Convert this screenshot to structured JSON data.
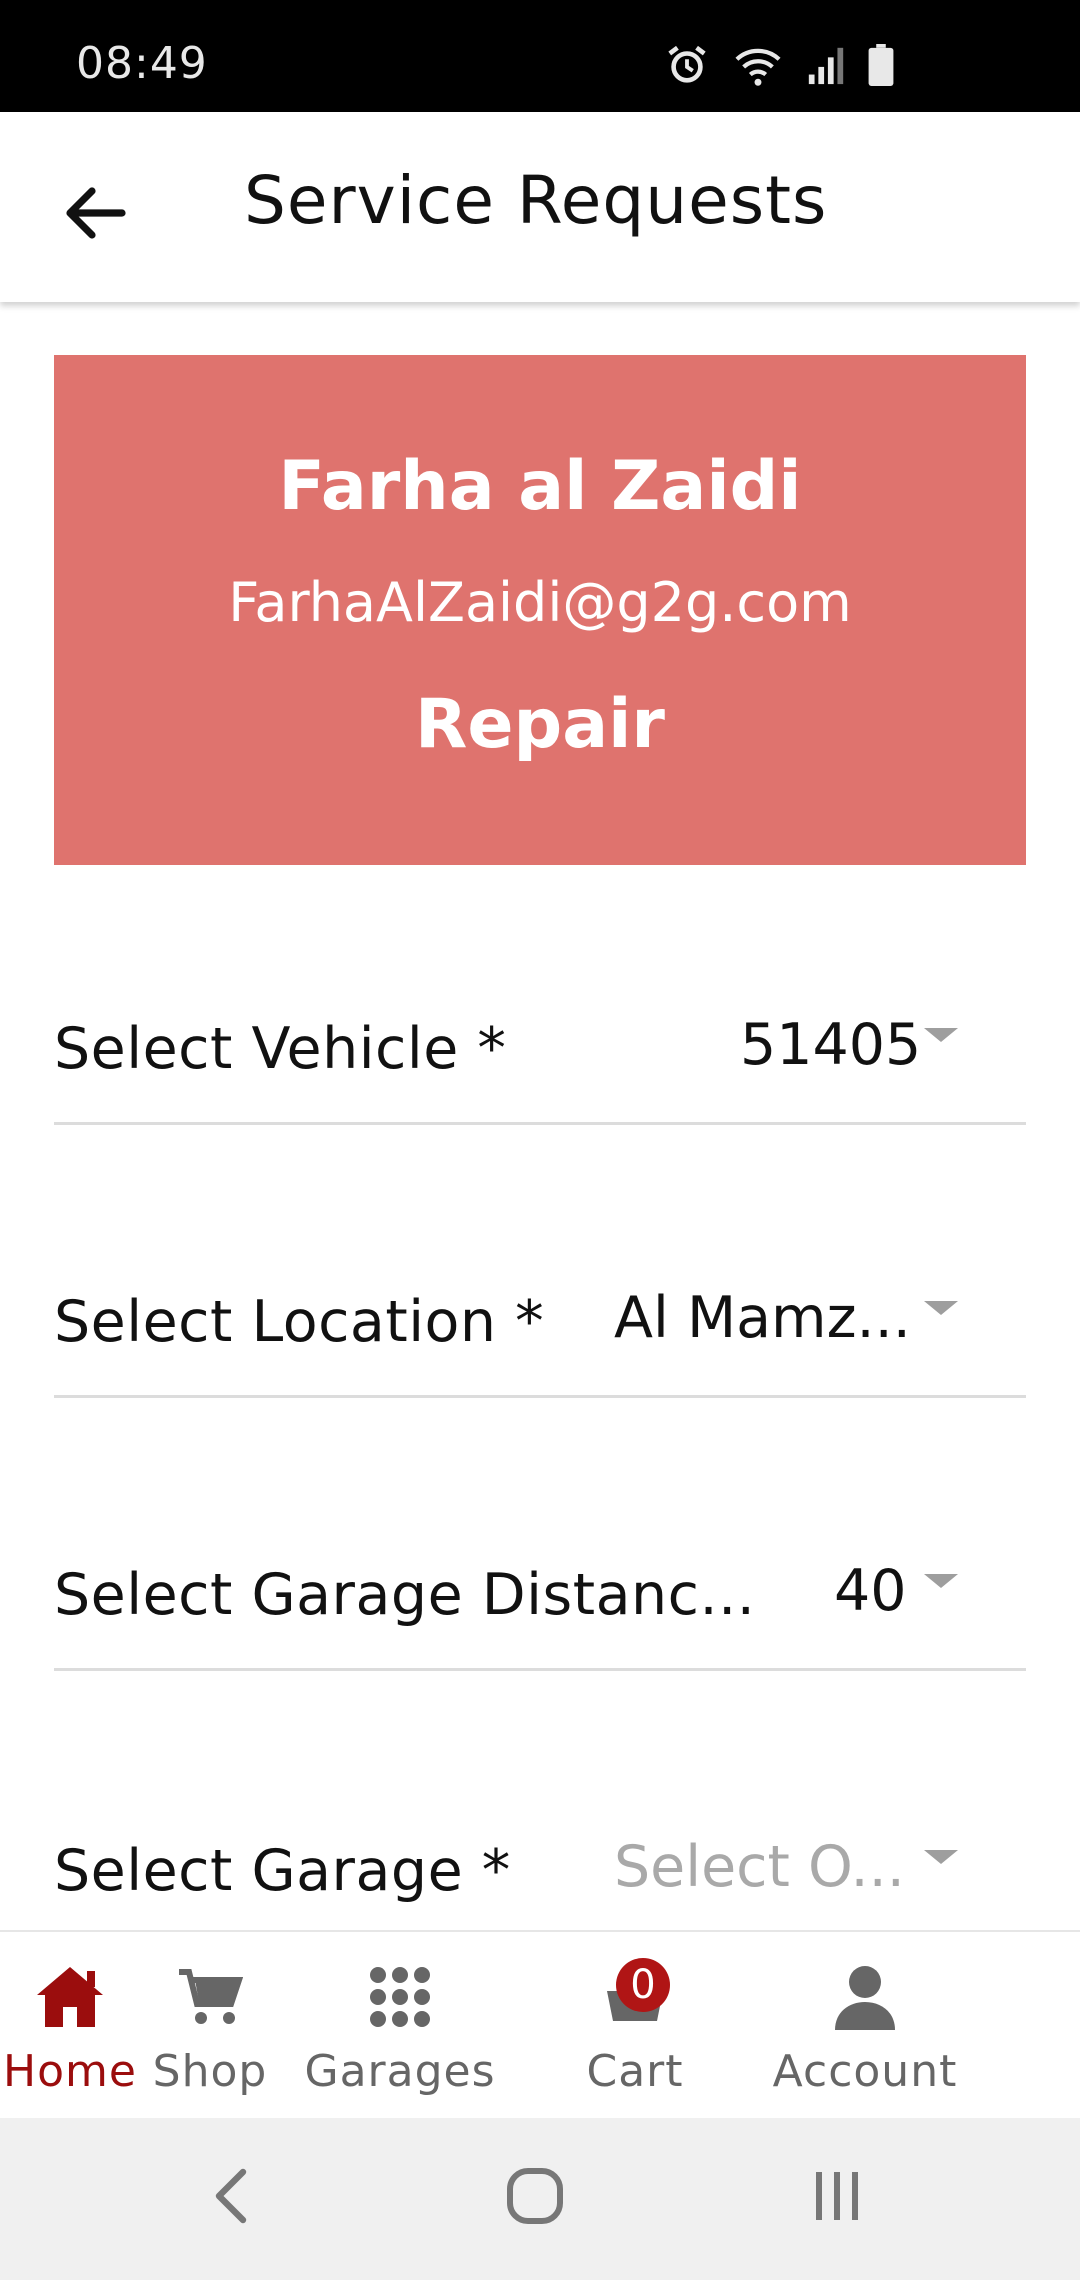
{
  "status_bar": {
    "time": "08:49",
    "icons": [
      "alarm-icon",
      "wifi-icon",
      "signal-icon",
      "battery-icon"
    ]
  },
  "header": {
    "title": "Service Requests",
    "back_icon": "arrow-left-icon"
  },
  "banner": {
    "name": "Farha al Zaidi",
    "email": "FarhaAlZaidi@g2g.com",
    "service_type": "Repair",
    "background_color": "#df736e"
  },
  "form": {
    "vehicle": {
      "label": "Select Vehicle *",
      "value": "51405"
    },
    "location": {
      "label": "Select Location *",
      "value": "Al Mamz..."
    },
    "garage_distance": {
      "label": "Select Garage Distanc...",
      "value": "40"
    },
    "garage": {
      "label": "Select Garage *",
      "placeholder": "Select O..."
    }
  },
  "bottom_nav": {
    "items": [
      {
        "label": "Home",
        "icon": "home-icon",
        "active": true
      },
      {
        "label": "Shop",
        "icon": "shopping-cart-icon",
        "active": false
      },
      {
        "label": "Garages",
        "icon": "grid-dots-icon",
        "active": false
      },
      {
        "label": "Cart",
        "icon": "basket-icon",
        "active": false,
        "badge": "0"
      },
      {
        "label": "Account",
        "icon": "person-icon",
        "active": false
      }
    ],
    "active_color": "#9b0d0d"
  },
  "system_nav": [
    "back-icon",
    "home-circle-icon",
    "recents-icon"
  ]
}
